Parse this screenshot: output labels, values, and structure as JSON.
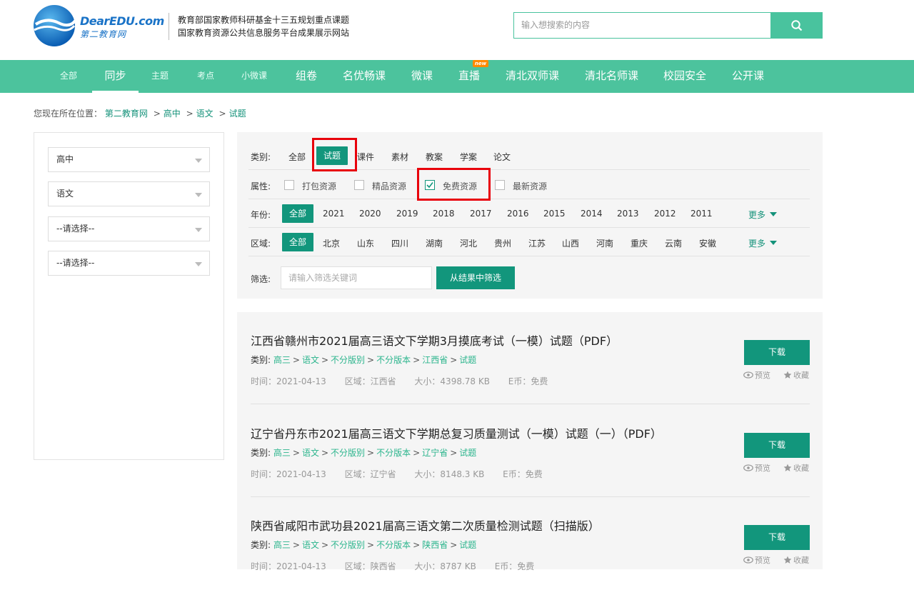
{
  "header": {
    "logo_name": "DearEDU.com",
    "logo_sub": "第二教育网",
    "slogan_line1": "教育部国家教师科研基金十三五规划重点课题",
    "slogan_line2": "国家教育资源公共信息服务平台成果展示网站",
    "search_placeholder": "输入想搜索的内容"
  },
  "nav": {
    "items": [
      "全部",
      "同步",
      "主题",
      "考点",
      "小微课",
      "组卷",
      "名优畅课",
      "微课",
      "直播",
      "清北双师课",
      "清北名师课",
      "校园安全",
      "公开课"
    ],
    "active": "同步",
    "new_badge": "new"
  },
  "breadcrumb": {
    "prefix": "您现在所在位置：",
    "links": [
      "第二教育网",
      "高中",
      "语文",
      "试题"
    ],
    "sep": ">"
  },
  "sidebar": {
    "selects": [
      "高中",
      "语文",
      "--请选择--",
      "--请选择--"
    ]
  },
  "filter": {
    "category_label": "类别:",
    "categories": [
      "全部",
      "试题",
      "课件",
      "素材",
      "教案",
      "学案",
      "论文"
    ],
    "attribute_label": "属性:",
    "attributes": [
      "打包资源",
      "精品资源",
      "免费资源",
      "最新资源"
    ],
    "year_label": "年份:",
    "years": [
      "全部",
      "2021",
      "2020",
      "2019",
      "2018",
      "2017",
      "2016",
      "2015",
      "2014",
      "2013",
      "2012",
      "2011"
    ],
    "region_label": "区域:",
    "regions": [
      "全部",
      "北京",
      "山东",
      "四川",
      "湖南",
      "河北",
      "贵州",
      "江苏",
      "山西",
      "河南",
      "重庆",
      "云南",
      "安徽"
    ],
    "more": "更多",
    "screen_label": "筛选:",
    "screen_placeholder": "请输入筛选关键词",
    "screen_button": "从结果中筛选"
  },
  "results": [
    {
      "title": "江西省赣州市2021届高三语文下学期3月摸底考试（一模）试题（PDF）",
      "cat_label": "类别:",
      "cats": [
        "高三",
        "语文",
        "不分版别",
        "不分版本",
        "江西省",
        "试题"
      ],
      "time": "时间：2021-04-13",
      "region": "区域：江西省",
      "size": "大小：4398.78 KB",
      "coin": "E币：免费"
    },
    {
      "title": "辽宁省丹东市2021届高三语文下学期总复习质量测试（一模）试题（一）（PDF）",
      "cat_label": "类别:",
      "cats": [
        "高三",
        "语文",
        "不分版别",
        "不分版本",
        "辽宁省",
        "试题"
      ],
      "time": "时间：2021-04-13",
      "region": "区域：辽宁省",
      "size": "大小：8148.3 KB",
      "coin": "E币：免费"
    },
    {
      "title": "陕西省咸阳市武功县2021届高三语文第二次质量检测试题（扫描版）",
      "cat_label": "类别:",
      "cats": [
        "高三",
        "语文",
        "不分版别",
        "不分版本",
        "陕西省",
        "试题"
      ],
      "time": "时间：2021-04-13",
      "region": "区域：陕西省",
      "size": "大小：8787 KB",
      "coin": "E币：免费"
    }
  ],
  "actions": {
    "download": "下载",
    "preview": "预览",
    "favorite": "收藏"
  },
  "colors": {
    "brand_green": "#4cc39d",
    "dark_green": "#12967c",
    "highlight_red": "#e8000b"
  }
}
